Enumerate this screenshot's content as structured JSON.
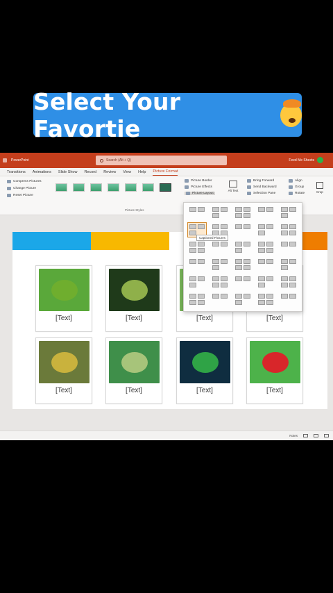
{
  "banner": {
    "text": "Select Your Favortie",
    "emoji_icon": "exploding-head-icon"
  },
  "app": {
    "title": "PowerPoint",
    "search_placeholder": "Search (Alt + Q)",
    "user_name": "Feed Me Sheets",
    "tabs": [
      "Transitions",
      "Animations",
      "Slide Show",
      "Record",
      "Review",
      "View",
      "Help",
      "Picture Format"
    ],
    "active_tab": "Picture Format",
    "ribbon": {
      "adjust": [
        "Compress Pictures",
        "Change Picture",
        "Reset Picture"
      ],
      "styles_label": "Picture Styles",
      "picture_menu": [
        "Picture Border",
        "Picture Effects",
        "Picture Layout"
      ],
      "alt_text": "Alt Text",
      "arrange": [
        "Bring Forward",
        "Send Backward",
        "Selection Pane"
      ],
      "arrange2": [
        "Align",
        "Group",
        "Rotate"
      ],
      "crop": "Crop"
    },
    "gallery_tooltip": "Captioned Pictures",
    "status": {
      "notes": "Notes"
    }
  },
  "slide": {
    "cards": [
      {
        "caption": "[Text]",
        "bg": "#5aa83a",
        "frog": "#6fae2e"
      },
      {
        "caption": "[Text]",
        "bg": "#1f3a1a",
        "frog": "#8fb04a"
      },
      {
        "caption": "[Text]",
        "bg": "#78b45a",
        "frog": "#9bc26b"
      },
      {
        "caption": "[Text]",
        "bg": "#ffffff",
        "frog": "#ffffff"
      },
      {
        "caption": "[Text]",
        "bg": "#6b7a3a",
        "frog": "#c9b23d"
      },
      {
        "caption": "[Text]",
        "bg": "#3f8f4a",
        "frog": "#a7c47a"
      },
      {
        "caption": "[Text]",
        "bg": "#0f2d40",
        "frog": "#2fa346"
      },
      {
        "caption": "[Text]",
        "bg": "#4db24a",
        "frog": "#d8262a"
      }
    ],
    "band_colors": [
      "#1ba7e8",
      "#f8b800",
      "#ef7d00"
    ]
  }
}
